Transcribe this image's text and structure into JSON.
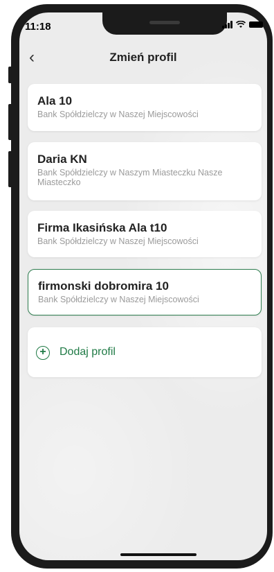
{
  "status_bar": {
    "time": "11:18"
  },
  "header": {
    "title": "Zmień profil"
  },
  "profiles": [
    {
      "name": "Ala 10",
      "bank": "Bank Spółdzielczy w Naszej Miejscowości",
      "selected": false
    },
    {
      "name": "Daria KN",
      "bank": "Bank Spółdzielczy  w Naszym Miasteczku Nasze Miasteczko",
      "selected": false
    },
    {
      "name": "Firma Ikasińska Ala t10",
      "bank": "Bank Spółdzielczy w Naszej Miejscowości",
      "selected": false
    },
    {
      "name": "firmonski dobromira 10",
      "bank": "Bank Spółdzielczy w Naszej Miejscowości",
      "selected": true
    }
  ],
  "add_profile": {
    "label": "Dodaj profil"
  },
  "colors": {
    "accent": "#1f7a45",
    "selected_border": "#2e7d4f"
  }
}
